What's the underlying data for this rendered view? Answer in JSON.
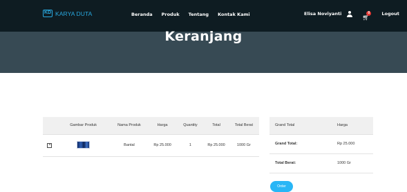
{
  "header": {
    "logo_mark": "KD",
    "brand": "KARYA DUTA",
    "nav": [
      "Beranda",
      "Produk",
      "Tentang",
      "Kontak Kami"
    ],
    "user_name": "Elisa Noviyanti",
    "cart_count": "0",
    "logout": "Logout"
  },
  "hero": {
    "title": "Keranjang"
  },
  "cart_table": {
    "columns": [
      "",
      "Gambar Produk",
      "Nama Produk",
      "Harga",
      "Quantity",
      "Total",
      "Total Berat"
    ],
    "rows": [
      {
        "remove": "×",
        "image_icon": "pillow-product-image",
        "name": "Bantal",
        "price": "Rp 25.000",
        "qty": "1",
        "total": "Rp 25.000",
        "weight": "1000 Gr"
      }
    ]
  },
  "summary": {
    "header_left": "Grand Total",
    "header_right": "Harga",
    "grand_total_label": "Grand Total:",
    "grand_total_value": "Rp 25.000",
    "total_weight_label": "Total Berat:",
    "total_weight_value": "1000 Gr"
  },
  "order_button": "Order",
  "colors": {
    "topbar": "#0e1c22",
    "hero": "#374a54",
    "accent": "#29a9e0",
    "button": "#29b6f6"
  }
}
